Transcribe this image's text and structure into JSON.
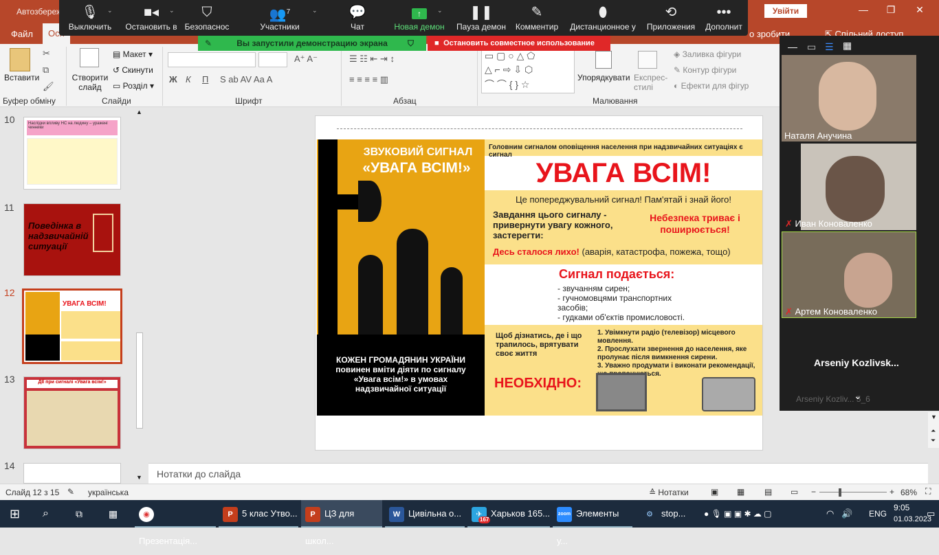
{
  "titlebar": {
    "title": "Автозбереж",
    "login": "Увійти",
    "minimize": "—",
    "restore": "❐",
    "close": "✕"
  },
  "tabs": {
    "file": "Файл",
    "home": "Осн",
    "hint": "о зробити",
    "share": "Спільний доступ"
  },
  "zoom": {
    "mute": "Выключить",
    "video": "Остановить в",
    "security": "Безопаснос",
    "participants": "Участники",
    "participants_count": "7",
    "chat": "Чат",
    "newshare": "Новая демон",
    "pause": "Пауза демон",
    "annotate": "Комментир",
    "remote": "Дистанционное у",
    "apps": "Приложения",
    "more": "Дополнит",
    "sharing_notice": "Вы запустили демонстрацию экрана",
    "stop_share": "Остановить совместное использование"
  },
  "ribbon": {
    "paste": "Вставити",
    "clipboard": "Буфер обміну",
    "new_slide": "Створити слайд",
    "layout": "Макет",
    "reset": "Скинути",
    "section": "Розділ",
    "slides": "Слайди",
    "font_group": "Шрифт",
    "paragraph": "Абзац",
    "drawing": "Малювання",
    "arrange": "Упорядкувати",
    "quick_styles": "Експрес-стилі",
    "shape_fill": "Заливка фігури",
    "shape_outline": "Контур фігури",
    "shape_effects": "Ефекти для фігур",
    "bold": "Ж",
    "italic": "К",
    "underline": "П"
  },
  "thumbs": [
    {
      "num": "10",
      "text": "Наслідки впливу НС на людину – уражені чинники"
    },
    {
      "num": "11",
      "text": "Поведінка в надзвичайній ситуації"
    },
    {
      "num": "12",
      "text": "УВАГА ВСІМ!"
    },
    {
      "num": "13",
      "text": "ДІЇ при сигналі «Увага всім!»"
    },
    {
      "num": "14",
      "text": ""
    }
  ],
  "slide": {
    "left_title1": "ЗВУКОВИЙ СИГНАЛ",
    "left_title2": "«УВАГА ВСІМ!»",
    "top_line": "Головним сигналом оповіщення населення при надзвичайних ситуаціях є сигнал",
    "big": "УВАГА ВСІМ!",
    "warn": "Це попереджувальний сигнал! Пам'ятай і знай його!",
    "task": "Завдання цього сигналу - привернути увагу кожного, застерегти:",
    "danger": "Небезпека триває і поширюється!",
    "accident_red": "Десь сталося лихо!",
    "accident_rest": "(аварія, катастрофа, пожежа, тощо)",
    "signal_title": "Сигнал подається:",
    "signal_items": [
      "- звучанням сирен;",
      "- гучномовцями транспортних засобів;",
      "- гудками об'єктів промисловості."
    ],
    "left_bottom": "КОЖЕН ГРОМАДЯНИН УКРАЇНИ повинен вміти діяти по сигналу «Увага всім!» в умовах надзвичайної ситуації",
    "find_out": "Щоб дізнатись, де і що трапилось, врятувати своє життя",
    "steps": [
      "1. Увімкнути радіо (телевізор) місцевого мовлення.",
      "2. Прослухати звернення до населення, яке пролунає після вимкнення сирени.",
      "3. Уважно продумати і виконати рекомендації, що пропонуються."
    ],
    "necessary": "НЕОБХІДНО:"
  },
  "notes": "Нотатки до слайда",
  "participants": [
    {
      "name": "Наталя Анучина"
    },
    {
      "name": "Иван Коноваленко"
    },
    {
      "name": "Артем Коноваленко"
    },
    {
      "name": "Arseniy  Kozlivsk..."
    },
    {
      "name": "Arseniy Kozliv... 5_6"
    }
  ],
  "status": {
    "slide": "Слайд 12 з 15",
    "lang": "українська",
    "notes": "Нотатки",
    "zoom": "68%"
  },
  "taskbar": {
    "items": [
      "Презентація...",
      "5 клас Утво...",
      "ЦЗ для школ...",
      "Цивільна о...",
      "Харьков 165...",
      "Элементы у...",
      "stop..."
    ],
    "badge": "167",
    "lang": "ENG",
    "time": "9:05",
    "date": "01.03.2023"
  },
  "colors": {
    "accent": "#b7472a",
    "zoom_bg": "#242424",
    "green": "#2fb84d",
    "red": "#e02828",
    "slide_red": "#e8141b",
    "slide_yellow": "#e8a413"
  }
}
